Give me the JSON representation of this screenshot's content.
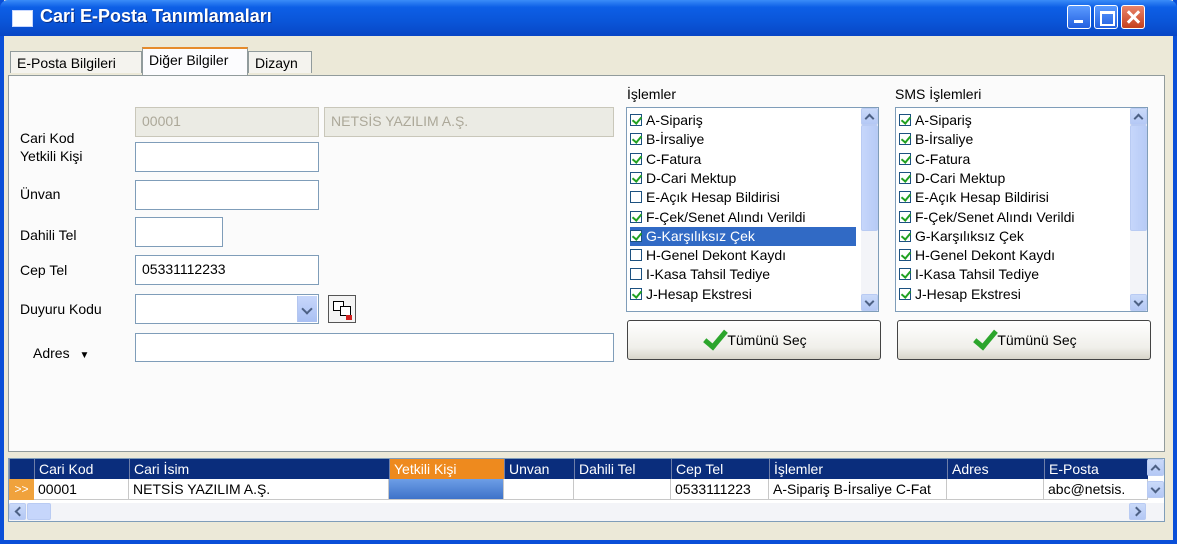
{
  "window": {
    "title": "Cari E-Posta Tanımlamaları"
  },
  "tabs": [
    {
      "label": "E-Posta Bilgileri",
      "active": false
    },
    {
      "label": "Diğer Bilgiler",
      "active": true
    },
    {
      "label": "Dizayn",
      "active": false
    }
  ],
  "form": {
    "cari_kod_label": "Cari Kod",
    "cari_kod_value": "00001",
    "cari_isim_value": "NETSİS YAZILIM A.Ş.",
    "yetkili_label": "Yetkili Kişi",
    "yetkili_value": "",
    "unvan_label": "Ünvan",
    "unvan_value": "",
    "dahili_label": "Dahili Tel",
    "dahili_value": "",
    "cep_label": "Cep Tel",
    "cep_value": "05331112233",
    "duyuru_label": "Duyuru Kodu",
    "duyuru_value": "",
    "adres_label": "Adres",
    "adres_value": ""
  },
  "islemler": {
    "title": "İşlemler",
    "items": [
      {
        "label": "A-Sipariş",
        "checked": true
      },
      {
        "label": "B-İrsaliye",
        "checked": true
      },
      {
        "label": "C-Fatura",
        "checked": true
      },
      {
        "label": "D-Cari Mektup",
        "checked": true
      },
      {
        "label": "E-Açık Hesap Bildirisi",
        "checked": false
      },
      {
        "label": "F-Çek/Senet Alındı Verildi",
        "checked": true
      },
      {
        "label": "G-Karşılıksız Çek",
        "checked": true,
        "selected": true
      },
      {
        "label": "H-Genel Dekont Kaydı",
        "checked": false
      },
      {
        "label": "I-Kasa Tahsil Tediye",
        "checked": false
      },
      {
        "label": "J-Hesap Ekstresi",
        "checked": true
      }
    ],
    "select_all": "Tümünü Seç"
  },
  "sms": {
    "title": "SMS İşlemleri",
    "items": [
      {
        "label": "A-Sipariş",
        "checked": true
      },
      {
        "label": "B-İrsaliye",
        "checked": true
      },
      {
        "label": "C-Fatura",
        "checked": true
      },
      {
        "label": "D-Cari Mektup",
        "checked": true
      },
      {
        "label": "E-Açık Hesap Bildirisi",
        "checked": true
      },
      {
        "label": "F-Çek/Senet Alındı Verildi",
        "checked": true
      },
      {
        "label": "G-Karşılıksız Çek",
        "checked": true
      },
      {
        "label": "H-Genel Dekont Kaydı",
        "checked": true
      },
      {
        "label": "I-Kasa Tahsil Tediye",
        "checked": true
      },
      {
        "label": "J-Hesap Ekstresi",
        "checked": true
      }
    ],
    "select_all": "Tümünü Seç"
  },
  "grid": {
    "columns": [
      "Cari Kod",
      "Cari İsim",
      "Yetkili Kişi",
      "Unvan",
      "Dahili Tel",
      "Cep Tel",
      "İşlemler",
      "Adres",
      "E-Posta"
    ],
    "highlighted_column": "Yetkili Kişi",
    "row_marker": ">>",
    "rows": [
      [
        "00001",
        "NETSİS YAZILIM A.Ş.",
        "",
        "",
        "",
        "0533111223",
        "A-Sipariş B-İrsaliye C-Fat",
        "",
        "abc@netsis."
      ]
    ]
  }
}
